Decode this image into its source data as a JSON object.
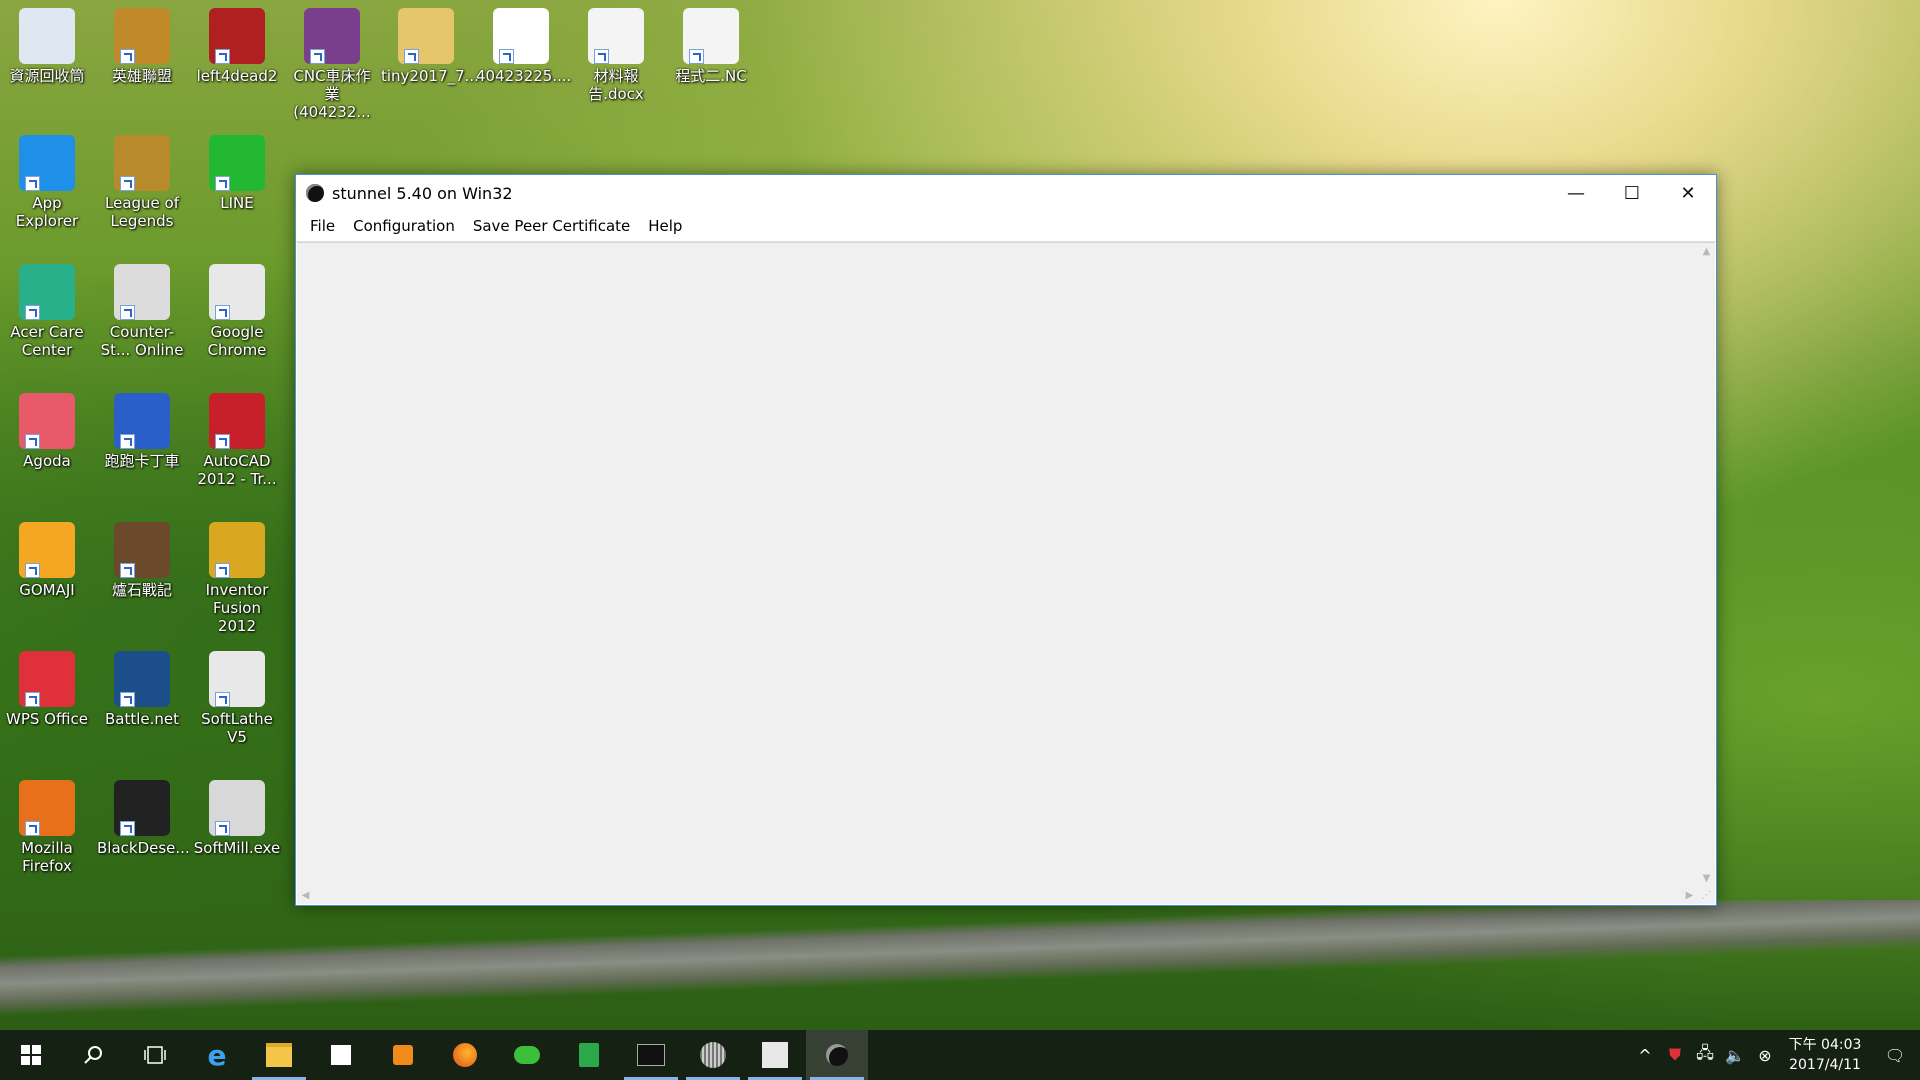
{
  "desktop": {
    "icons": [
      {
        "label": "資源回收筒",
        "color": "#dfe8f2"
      },
      {
        "label": "英雄聯盟",
        "color": "#c08a2a"
      },
      {
        "label": "left4dead2",
        "color": "#b02020"
      },
      {
        "label": "CNC車床作業(404232...",
        "color": "#7a3f8c"
      },
      {
        "label": "tiny2017_7...",
        "color": "#e6c66a"
      },
      {
        "label": "40423225....",
        "color": "#ffffff"
      },
      {
        "label": "材料報告.docx",
        "color": "#f4f4f4"
      },
      {
        "label": "程式二.NC",
        "color": "#f4f4f4"
      },
      {
        "label": "App Explorer",
        "color": "#1e90e8"
      },
      {
        "label": "League of Legends",
        "color": "#b88a2c"
      },
      {
        "label": "LINE",
        "color": "#22b832"
      },
      {
        "label": "Acer Care Center",
        "color": "#27b08a"
      },
      {
        "label": "Counter-St... Online",
        "color": "#dcdcdc"
      },
      {
        "label": "Google Chrome",
        "color": "#e8e8e8"
      },
      {
        "label": "Agoda",
        "color": "#e85a6a"
      },
      {
        "label": "跑跑卡丁車",
        "color": "#2a5ec8"
      },
      {
        "label": "AutoCAD 2012 - Tr...",
        "color": "#c8202a"
      },
      {
        "label": "GOMAJI",
        "color": "#f5a623"
      },
      {
        "label": "爐石戰記",
        "color": "#6a4a2a"
      },
      {
        "label": "Inventor Fusion 2012",
        "color": "#d9a820"
      },
      {
        "label": "WPS Office",
        "color": "#e0303a"
      },
      {
        "label": "Battle.net",
        "color": "#1c4e8c"
      },
      {
        "label": "SoftLathe V5",
        "color": "#e8e8e8"
      },
      {
        "label": "Mozilla Firefox",
        "color": "#e8701a"
      },
      {
        "label": "BlackDese...",
        "color": "#222222"
      },
      {
        "label": "SoftMill.exe",
        "color": "#d8d8d8"
      }
    ]
  },
  "window": {
    "title": "stunnel 5.40 on Win32",
    "menu": [
      "File",
      "Configuration",
      "Save Peer Certificate",
      "Help"
    ],
    "minimize": "—",
    "maximize": "☐",
    "close": "✕"
  },
  "taskbar": {
    "apps": [
      "start",
      "search",
      "task-view",
      "edge",
      "file-explorer",
      "store",
      "media-player",
      "firefox",
      "cloud-app",
      "spreadsheet",
      "terminal",
      "sphere-app",
      "cad-app",
      "stunnel"
    ],
    "clock_line1": "下午 04:03",
    "clock_line2": "2017/4/11"
  }
}
